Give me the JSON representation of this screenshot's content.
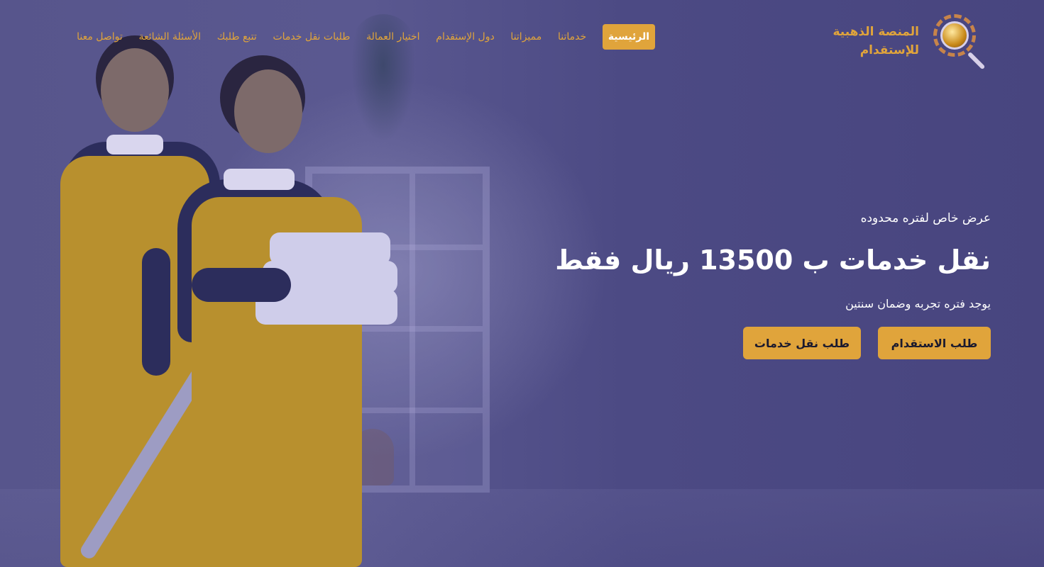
{
  "brand": {
    "name_line1": "المنصة الذهبية",
    "name_line2": "للإستقدام",
    "logo_icon": "globe-magnifier-icon",
    "accent_color": "#e0a43b"
  },
  "nav": {
    "items": [
      {
        "label": "الرئيسية",
        "active": true
      },
      {
        "label": "خدماتنا"
      },
      {
        "label": "مميزاتنا"
      },
      {
        "label": "دول الإستقدام"
      },
      {
        "label": "اختيار العمالة"
      },
      {
        "label": "طلبات نقل خدمات"
      },
      {
        "label": "تتبع طلبك"
      },
      {
        "label": "الأسئلة الشائعة"
      },
      {
        "label": "تواصل معنا"
      }
    ]
  },
  "hero": {
    "tagline": "عرض خاص لفتره محدوده",
    "headline": "نقل خدمات ب 13500 ريال فقط",
    "subtext": "يوجد فتره تجربه وضمان سنتين",
    "primary_cta": "طلب الاستقدام",
    "secondary_cta": "طلب نقل خدمات",
    "overlay_color": "#4b4880"
  }
}
